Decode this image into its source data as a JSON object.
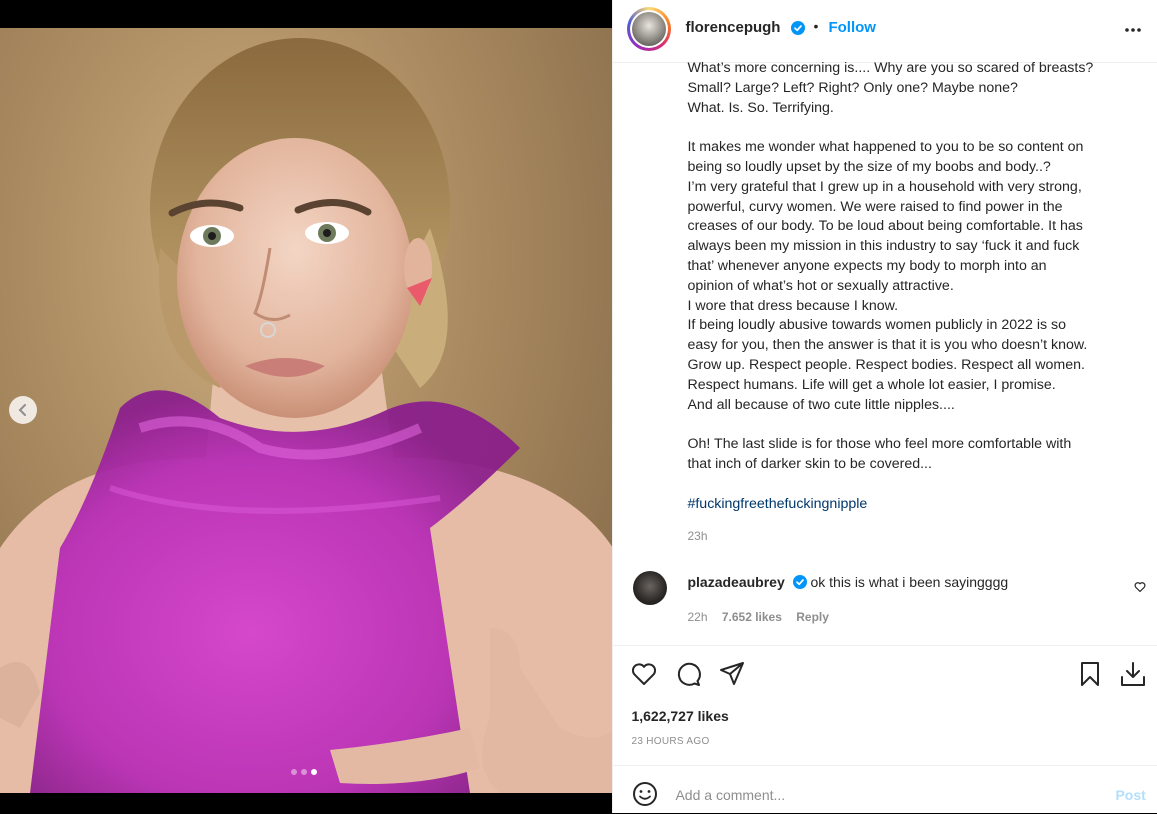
{
  "post": {
    "username": "florencepugh",
    "separator": "•",
    "follow_label": "Follow",
    "caption_paragraphs": [
      "What’s more concerning is.... Why are you so scared of breasts?\nSmall? Large? Left? Right? Only one? Maybe none?\nWhat. Is. So. Terrifying.",
      "It makes me wonder what happened to you to be so content on\nbeing so loudly upset by the size of my boobs and body..?\nI’m very grateful that I grew up in a household with very strong,\npowerful, curvy women. We were raised to find power in the\ncreases of our body. To be loud about being comfortable. It has\nalways been my mission in this industry to say ‘fuck it and fuck\nthat’ whenever anyone expects my body to morph into an\nopinion of what’s hot or sexually attractive.\nI wore that dress because I know.\nIf being loudly abusive towards women publicly in 2022 is so\neasy for you, then the answer is that it is you who doesn’t know.\nGrow up. Respect people. Respect bodies. Respect all women.\nRespect humans. Life will get a whole lot easier, I promise.\nAnd all because of two cute little nipples....",
      "Oh! The last slide is for those who feel more comfortable with\nthat inch of darker skin to be covered..."
    ],
    "hashtag": "#fuckingfreethefuckingnipple",
    "caption_time": "23h",
    "likes": "1,622,727 likes",
    "posted_ago": "23 HOURS AGO"
  },
  "comment": {
    "username": "plazadeaubrey",
    "text": "ok this is what i been sayingggg",
    "time": "22h",
    "likes": "7.652 likes",
    "reply_label": "Reply"
  },
  "add_comment": {
    "placeholder": "Add a comment...",
    "post_label": "Post"
  },
  "carousel": {
    "slide_count": 3,
    "active_slide": 3
  },
  "colors": {
    "accent": "#0095f6",
    "verified": "#0095f6",
    "dress": "#c833c8",
    "hashtag": "#00376b"
  },
  "icons": [
    "more-options-icon",
    "verified-badge-icon",
    "heart-icon",
    "comment-icon",
    "share-icon",
    "bookmark-icon",
    "download-icon",
    "emoji-icon",
    "chevron-left-icon"
  ]
}
